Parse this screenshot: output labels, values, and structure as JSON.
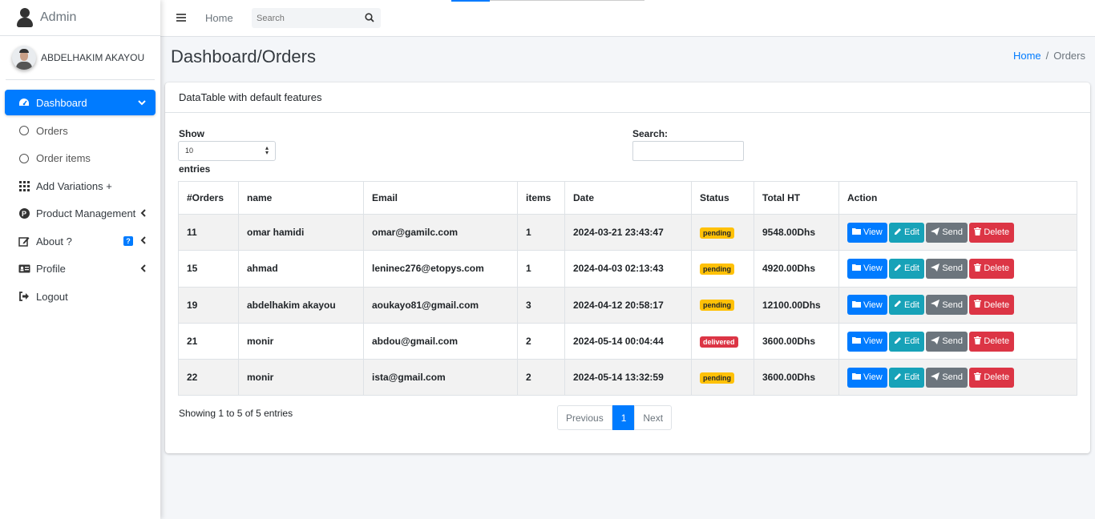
{
  "brand": {
    "text": "Admin"
  },
  "user": {
    "name": "ABDELHAKIM AKAYOU"
  },
  "sidebar": {
    "items": [
      {
        "label": "Dashboard",
        "icon": "tachometer-icon"
      },
      {
        "label": "Orders",
        "icon": "circle-icon"
      },
      {
        "label": "Order items",
        "icon": "circle-icon"
      },
      {
        "label": "Add Variations +",
        "icon": "grid-icon"
      },
      {
        "label": "Product Management",
        "icon": "p-circle-icon"
      },
      {
        "label": "About ?",
        "icon": "edit-icon",
        "badge": "?"
      },
      {
        "label": "Profile",
        "icon": "id-card-icon"
      },
      {
        "label": "Logout",
        "icon": "sign-out-icon"
      }
    ]
  },
  "navbar": {
    "home": "Home",
    "search_placeholder": "Search"
  },
  "page": {
    "title": "Dashboard/Orders",
    "breadcrumb": {
      "home": "Home",
      "sep": "/",
      "current": "Orders"
    }
  },
  "card": {
    "title": "DataTable with default features",
    "show_label": "Show",
    "show_value": "10",
    "entries_label": "entries",
    "search_label": "Search:",
    "columns": [
      "#Orders",
      "name",
      "Email",
      "items",
      "Date",
      "Status",
      "Total HT",
      "Action"
    ],
    "rows": [
      {
        "id": "11",
        "name": "omar hamidi",
        "email": "omar@gamilc.com",
        "items": "1",
        "date": "2024-03-21 23:43:47",
        "status": "pending",
        "total": "9548.00Dhs"
      },
      {
        "id": "15",
        "name": "ahmad",
        "email": "leninec276@etopys.com",
        "items": "1",
        "date": "2024-04-03 02:13:43",
        "status": "pending",
        "total": "4920.00Dhs"
      },
      {
        "id": "19",
        "name": "abdelhakim akayou",
        "email": "aoukayo81@gmail.com",
        "items": "3",
        "date": "2024-04-12 20:58:17",
        "status": "pending",
        "total": "12100.00Dhs"
      },
      {
        "id": "21",
        "name": "monir",
        "email": "abdou@gmail.com",
        "items": "2",
        "date": "2024-05-14 00:04:44",
        "status": "delivered",
        "total": "3600.00Dhs"
      },
      {
        "id": "22",
        "name": "monir",
        "email": "ista@gmail.com",
        "items": "2",
        "date": "2024-05-14 13:32:59",
        "status": "pending",
        "total": "3600.00Dhs"
      }
    ],
    "buttons": {
      "view": "View",
      "edit": "Edit",
      "send": "Send",
      "delete": "Delete"
    },
    "info": "Showing 1 to 5 of 5 entries",
    "pagination": {
      "prev": "Previous",
      "current": "1",
      "next": "Next"
    }
  },
  "colors": {
    "primary": "#007bff",
    "info": "#17a2b8",
    "secondary": "#6c757d",
    "danger": "#dc3545",
    "warning": "#ffc107"
  }
}
